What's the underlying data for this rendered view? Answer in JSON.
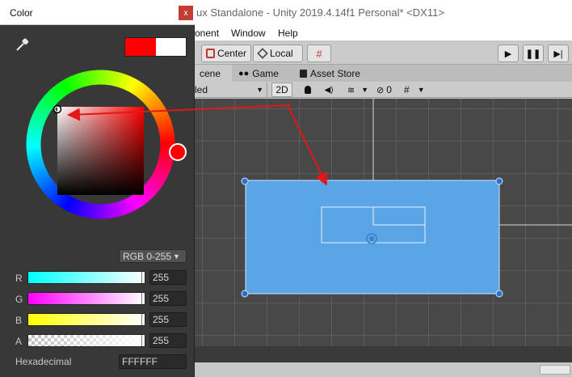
{
  "unity": {
    "title": "ux Standalone - Unity 2019.4.14f1 Personal* <DX11>",
    "menu": [
      "onent",
      "Window",
      "Help"
    ],
    "toolbar": {
      "pivot_label": "Center",
      "space_label": "Local"
    },
    "tabs": [
      {
        "label": "cene",
        "icon": "scene-icon"
      },
      {
        "label": "Game",
        "icon": "gamepad-icon"
      },
      {
        "label": "Asset Store",
        "icon": "shopping-bag-icon"
      }
    ],
    "scene_toolbar": {
      "shading_mode": "led",
      "mode_2d": "2D",
      "hidden_count": "0"
    },
    "colors": {
      "selection_fill": "#5aa5e6",
      "selection_outline": "#cfe6fb",
      "handle": "#2f6fd0",
      "scene_bg": "#484848"
    }
  },
  "color_picker": {
    "title": "Color",
    "close_glyph": "x",
    "old_color": "#ff0000",
    "new_color": "#ffffff",
    "mode": "RGB 0-255",
    "channels": [
      {
        "label": "R",
        "value": "255",
        "gradient": [
          "#00ffff",
          "#ffffff"
        ]
      },
      {
        "label": "G",
        "value": "255",
        "gradient": [
          "#ff00ff",
          "#ffffff"
        ]
      },
      {
        "label": "B",
        "value": "255",
        "gradient": [
          "#ffff00",
          "#ffffff"
        ]
      },
      {
        "label": "A",
        "value": "255",
        "gradient": [
          "transparent",
          "#ffffff"
        ]
      }
    ],
    "hex_label": "Hexadecimal",
    "hex_value": "FFFFFF"
  },
  "annotation": {
    "arrow_color": "#e01818"
  }
}
